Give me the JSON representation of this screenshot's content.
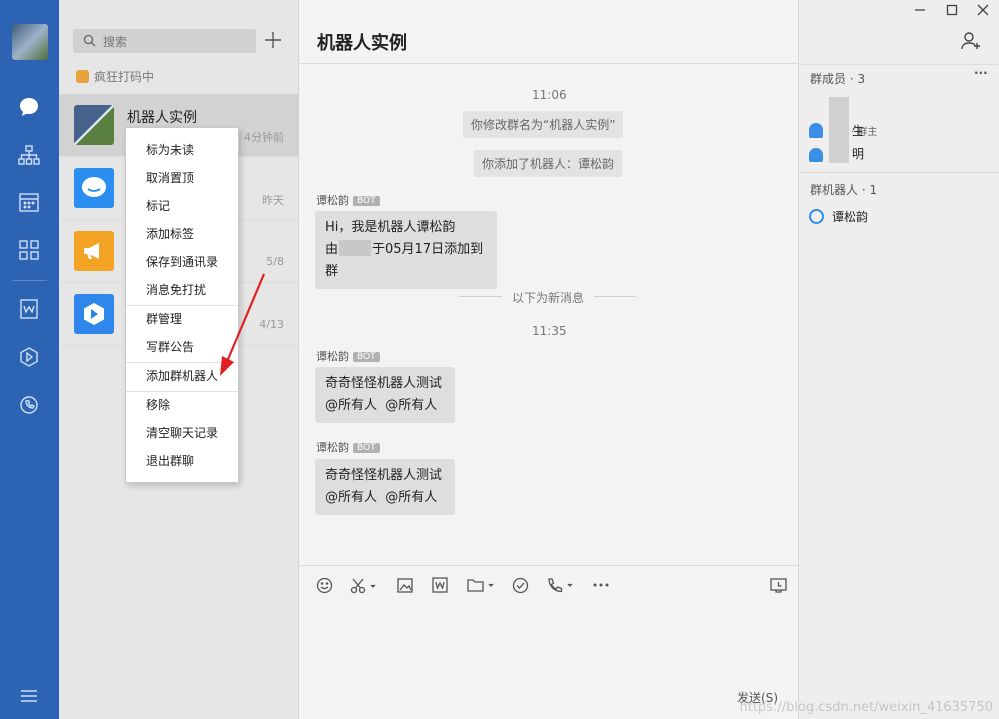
{
  "search": {
    "placeholder": "搜索"
  },
  "status": "疯狂打码中",
  "conversations": [
    {
      "name": "机器人实例",
      "time": "4分钟前"
    },
    {
      "name": "",
      "time": "昨天"
    },
    {
      "name": "",
      "time": "5/8"
    },
    {
      "name": "",
      "time": "4/13"
    }
  ],
  "context_menu": [
    "标为未读",
    "取消置顶",
    "标记",
    "添加标签",
    "保存到通讯录",
    "消息免打扰",
    "群管理",
    "写群公告",
    "添加群机器人",
    "移除",
    "清空聊天记录",
    "退出群聊"
  ],
  "chat": {
    "title": "机器人实例",
    "time1": "11:06",
    "sys1": "你修改群名为“机器人实例”",
    "sys2": "你添加了机器人：谭松韵",
    "msg1": {
      "sender": "谭松韵",
      "badge": "BOT",
      "line1": "Hi，我是机器人谭松韵",
      "line2a": "由",
      "line2b": "于05月17日添加到群"
    },
    "new_divider": "以下为新消息",
    "time2": "11:35",
    "msg2": {
      "sender": "谭松韵",
      "badge": "BOT",
      "line1": "奇奇怪怪机器人测试",
      "line2": "@所有人  @所有人"
    },
    "msg3": {
      "sender": "谭松韵",
      "badge": "BOT",
      "line1": "奇奇怪怪机器人测试",
      "line2": "@所有人  @所有人"
    },
    "send_label": "发送(S)"
  },
  "side": {
    "members_header": "群成员 · 3",
    "more": "···",
    "members": [
      {
        "label": "· 群主"
      },
      {
        "label": "生"
      },
      {
        "label": "明"
      }
    ],
    "robots_header": "群机器人 · 1",
    "robots": [
      {
        "name": "谭松韵"
      }
    ]
  },
  "watermark": "https://blog.csdn.net/weixin_41635750",
  "colors": {
    "rail": "#2c63b3",
    "arrow": "#e02020",
    "bot_badge": "#b0b0b0"
  }
}
